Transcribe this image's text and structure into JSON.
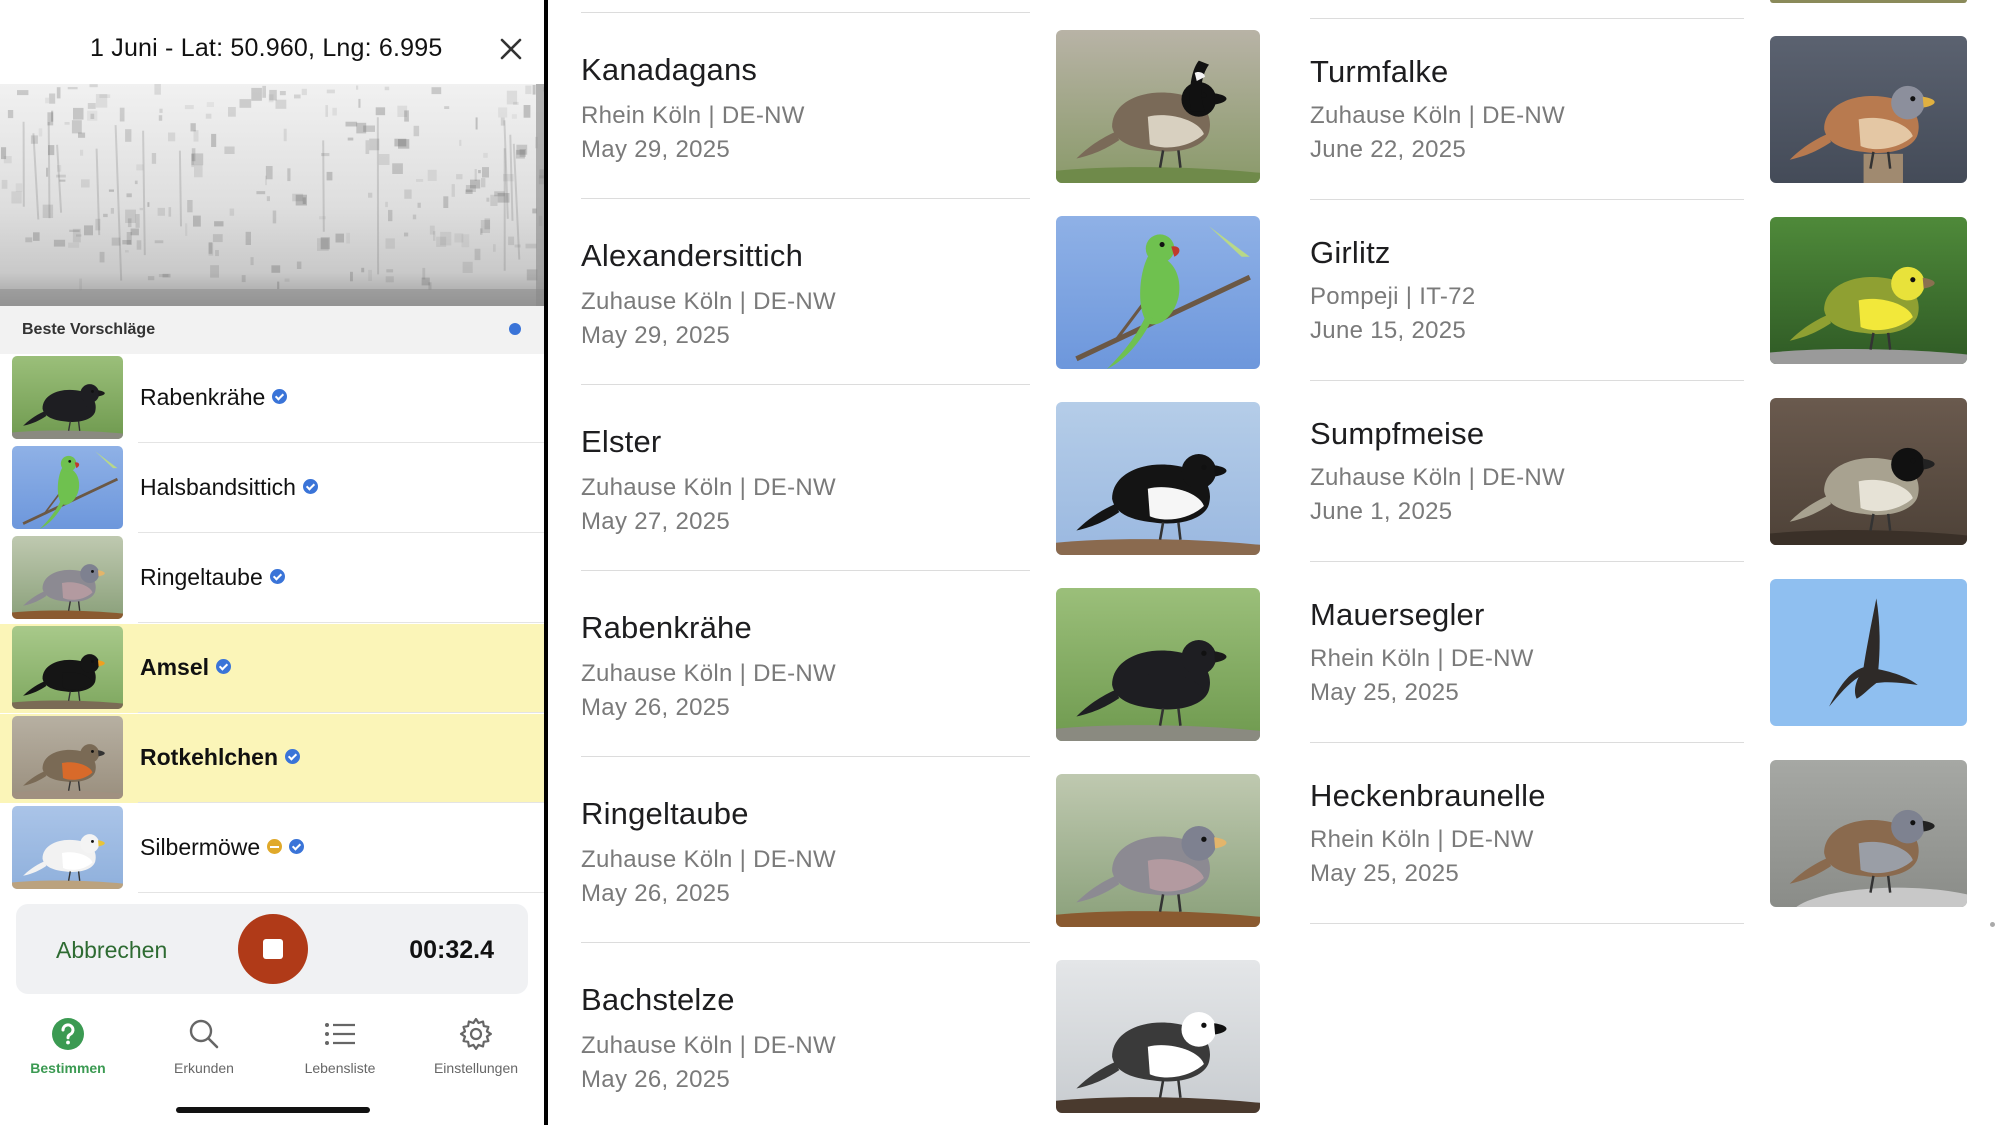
{
  "header": {
    "title": "1 Juni - Lat: 50.960, Lng: 6.995"
  },
  "suggestions": {
    "label": "Beste Vorschläge",
    "items": [
      {
        "name": "Rabenkrähe",
        "highlight": false,
        "badges": [
          "verified"
        ],
        "bird": "crow"
      },
      {
        "name": "Halsbandsittich",
        "highlight": false,
        "badges": [
          "verified"
        ],
        "bird": "parakeet"
      },
      {
        "name": "Ringeltaube",
        "highlight": false,
        "badges": [
          "verified"
        ],
        "bird": "pigeon"
      },
      {
        "name": "Amsel",
        "highlight": true,
        "badges": [
          "verified"
        ],
        "bird": "blackbird"
      },
      {
        "name": "Rotkehlchen",
        "highlight": true,
        "badges": [
          "verified"
        ],
        "bird": "robin"
      },
      {
        "name": "Silbermöwe",
        "highlight": false,
        "badges": [
          "gold",
          "verified"
        ],
        "bird": "gull"
      }
    ]
  },
  "recording": {
    "cancel_label": "Abbrechen",
    "time": "00:32.4"
  },
  "tabs": [
    {
      "label": "Bestimmen",
      "icon": "question-circle-icon",
      "active": true
    },
    {
      "label": "Erkunden",
      "icon": "search-icon",
      "active": false
    },
    {
      "label": "Lebensliste",
      "icon": "list-icon",
      "active": false
    },
    {
      "label": "Einstellungen",
      "icon": "gear-icon",
      "active": false
    }
  ],
  "sightings_left": [
    {
      "name": "Kanadagans",
      "location": "Rhein Köln | DE-NW",
      "date": "May 29, 2025",
      "bird": "goose"
    },
    {
      "name": "Alexandersittich",
      "location": "Zuhause Köln | DE-NW",
      "date": "May 29, 2025",
      "bird": "parakeet"
    },
    {
      "name": "Elster",
      "location": "Zuhause Köln | DE-NW",
      "date": "May 27, 2025",
      "bird": "magpie"
    },
    {
      "name": "Rabenkrähe",
      "location": "Zuhause Köln | DE-NW",
      "date": "May 26, 2025",
      "bird": "crow"
    },
    {
      "name": "Ringeltaube",
      "location": "Zuhause Köln | DE-NW",
      "date": "May 26, 2025",
      "bird": "pigeon"
    },
    {
      "name": "Bachstelze",
      "location": "Zuhause Köln | DE-NW",
      "date": "May 26, 2025",
      "bird": "wagtail"
    }
  ],
  "sightings_right": [
    {
      "name": "Turmfalke",
      "location": "Zuhause Köln | DE-NW",
      "date": "June 22, 2025",
      "bird": "kestrel"
    },
    {
      "name": "Girlitz",
      "location": "Pompeji | IT-72",
      "date": "June 15, 2025",
      "bird": "serin"
    },
    {
      "name": "Sumpfmeise",
      "location": "Zuhause Köln | DE-NW",
      "date": "June 1, 2025",
      "bird": "tit"
    },
    {
      "name": "Mauersegler",
      "location": "Rhein Köln | DE-NW",
      "date": "May 25, 2025",
      "bird": "swift"
    },
    {
      "name": "Heckenbraunelle",
      "location": "Rhein Köln | DE-NW",
      "date": "May 25, 2025",
      "bird": "dunnock"
    }
  ],
  "colors": {
    "accent_green": "#3b9a52",
    "highlight": "#fbf5b8",
    "record_red": "#b03a18",
    "verified_blue": "#3a74d8"
  }
}
